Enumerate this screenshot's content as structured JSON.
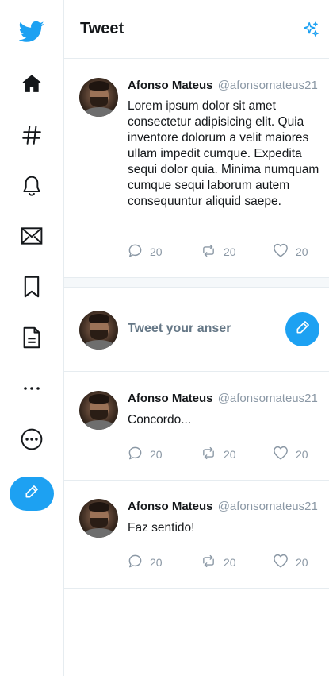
{
  "app": {
    "accent": "#1da1f2"
  },
  "sidebar": {
    "items": [
      {
        "name": "twitter-logo",
        "icon": "twitter-bird-icon"
      },
      {
        "name": "home",
        "icon": "home-icon"
      },
      {
        "name": "explore",
        "icon": "hashtag-icon"
      },
      {
        "name": "notifications",
        "icon": "bell-icon"
      },
      {
        "name": "messages",
        "icon": "mail-icon"
      },
      {
        "name": "bookmarks",
        "icon": "bookmark-icon"
      },
      {
        "name": "lists",
        "icon": "document-icon"
      },
      {
        "name": "more",
        "icon": "ellipsis-icon"
      },
      {
        "name": "more-menu",
        "icon": "more-circle-icon"
      },
      {
        "name": "compose",
        "icon": "pencil-icon"
      }
    ]
  },
  "header": {
    "title": "Tweet",
    "icon": "sparkle-icon"
  },
  "main_tweet": {
    "name": "Afonso Mateus",
    "handle": "@afonsomateus21",
    "text": "Lorem ipsum dolor sit amet consectetur adipisicing elit. Quia inventore dolorum a velit maiores ullam impedit cumque. Expedita sequi dolor quia. Minima numquam cumque sequi laborum autem consequuntur aliquid saepe.",
    "replies": "20",
    "retweets": "20",
    "likes": "20"
  },
  "reply": {
    "placeholder": "Tweet your anser"
  },
  "replies": [
    {
      "name": "Afonso Mateus",
      "handle": "@afonsomateus21",
      "text": "Concordo...",
      "replies": "20",
      "retweets": "20",
      "likes": "20"
    },
    {
      "name": "Afonso Mateus",
      "handle": "@afonsomateus21",
      "text": "Faz sentido!",
      "replies": "20",
      "retweets": "20",
      "likes": "20"
    }
  ]
}
